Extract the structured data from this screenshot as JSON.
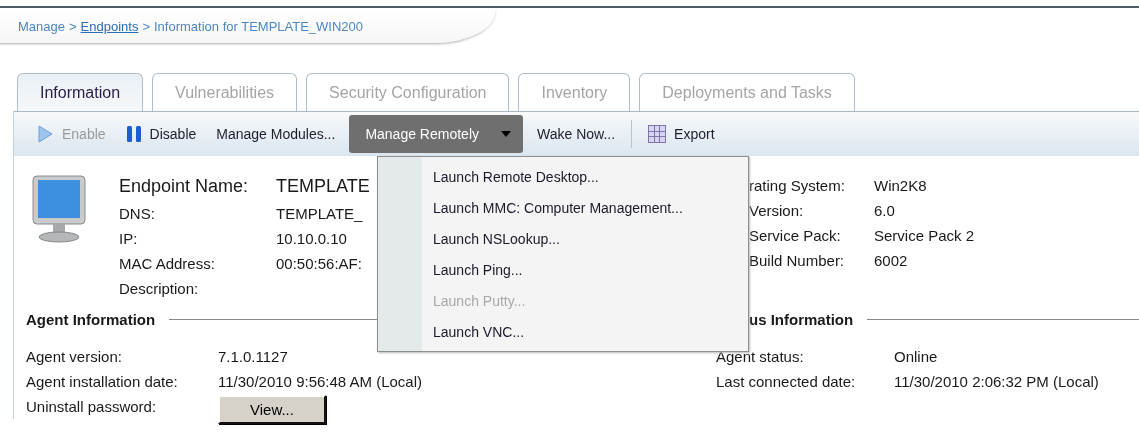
{
  "breadcrumb": [
    {
      "kind": "text",
      "label": "Manage"
    },
    {
      "kind": "separator",
      "label": ">"
    },
    {
      "kind": "link",
      "label": "Endpoints"
    },
    {
      "kind": "separator",
      "label": ">"
    },
    {
      "kind": "text",
      "label": "Information for TEMPLATE_WIN200"
    }
  ],
  "tabs": [
    {
      "label": "Information",
      "selected": true
    },
    {
      "label": "Vulnerabilities",
      "selected": false
    },
    {
      "label": "Security Configuration",
      "selected": false
    },
    {
      "label": "Inventory",
      "selected": false
    },
    {
      "label": "Deployments and Tasks",
      "selected": false
    }
  ],
  "toolbar": [
    {
      "kind": "play",
      "label": "Enable",
      "disabled": true
    },
    {
      "kind": "pause",
      "label": "Disable",
      "disabled": false
    },
    {
      "kind": "action",
      "label": "Manage Modules...",
      "disabled": false
    },
    {
      "kind": "dropdown",
      "label": "Manage Remotely",
      "expanded": true
    },
    {
      "kind": "action",
      "label": "Wake Now...",
      "disabled": false
    },
    {
      "kind": "grid",
      "label": "Export",
      "disabled": false
    }
  ],
  "menu": [
    {
      "label": "Launch Remote Desktop...",
      "disabled": false
    },
    {
      "label": "Launch MMC: Computer Management...",
      "disabled": false
    },
    {
      "label": "Launch NSLookup...",
      "disabled": false
    },
    {
      "label": "Launch Ping...",
      "disabled": false
    },
    {
      "label": "Launch Putty...",
      "disabled": true
    },
    {
      "label": "Launch VNC...",
      "disabled": false
    }
  ],
  "endpoint": {
    "name_label": "Endpoint Name:",
    "name_value": "TEMPLATE",
    "fields": [
      {
        "label": "DNS:",
        "value": "TEMPLATE_"
      },
      {
        "label": "IP:",
        "value": "10.10.0.10"
      },
      {
        "label": "MAC Address:",
        "value": "00:50:56:AF:"
      },
      {
        "label": "Description:"
      }
    ],
    "system_fields": [
      {
        "label": "rating System:",
        "value": "Win2K8"
      },
      {
        "label": "Version:",
        "value": "6.0"
      },
      {
        "label": "Service Pack:",
        "value": "Service Pack 2"
      },
      {
        "label": "Build Number:",
        "value": "6002"
      }
    ]
  },
  "agent_information": {
    "title": "Agent Information",
    "fields": [
      {
        "label": "Agent version:",
        "value": "7.1.0.1127"
      },
      {
        "label": "Agent installation date:",
        "value": "11/30/2010 9:56:48 AM (Local)"
      }
    ],
    "uninstall_label": "Uninstall password:",
    "view_button": "View..."
  },
  "status_information": {
    "title": "us Information",
    "fields": [
      {
        "label": "Agent status:",
        "value": "Online"
      },
      {
        "label": "Last connected date:",
        "value": "11/30/2010 2:06:32 PM (Local)"
      }
    ]
  }
}
